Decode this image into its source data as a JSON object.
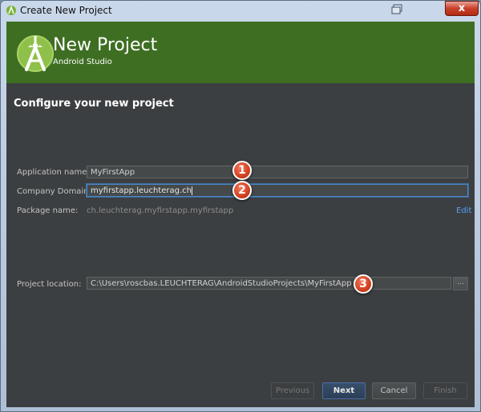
{
  "window": {
    "title": "Create New Project",
    "close_label": "x"
  },
  "header": {
    "title": "New Project",
    "subtitle": "Android Studio",
    "brand_color": "#3e6e22"
  },
  "section": {
    "title": "Configure your new project"
  },
  "form": {
    "app_name": {
      "label": "Application name:",
      "value": "MyFirstApp",
      "badge": "1"
    },
    "company_domain": {
      "label": "Company Domain:",
      "value": "myfirstapp.leuchterag.ch",
      "badge": "2"
    },
    "package_name": {
      "label": "Package name:",
      "value": "ch.leuchterag.myfirstapp.myfirstapp",
      "edit_label": "Edit"
    },
    "project_location": {
      "label": "Project location:",
      "value": "C:\\Users\\roscbas.LEUCHTERAG\\AndroidStudioProjects\\MyFirstApp",
      "badge": "3",
      "browse_label": "..."
    }
  },
  "buttons": {
    "previous": "Previous",
    "next": "Next",
    "cancel": "Cancel",
    "finish": "Finish"
  }
}
